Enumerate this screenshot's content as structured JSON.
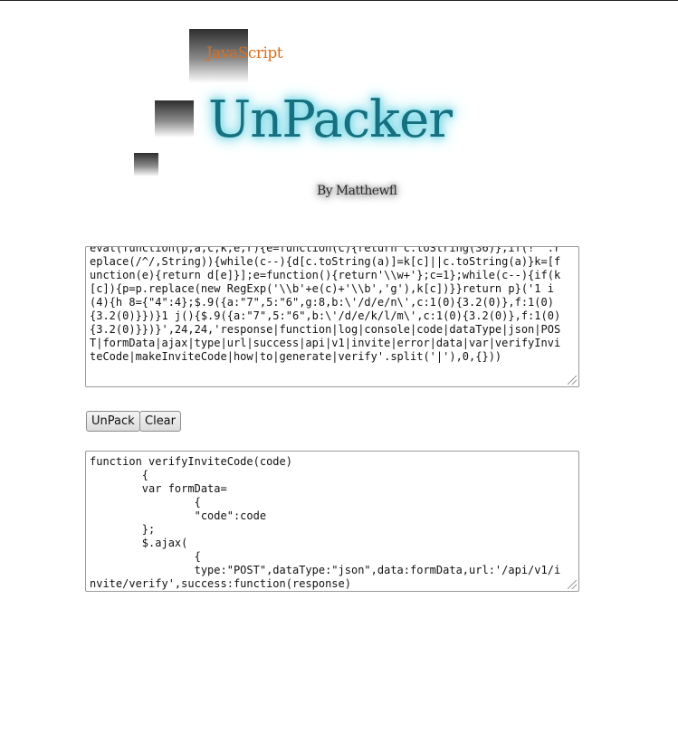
{
  "header": {
    "brand": "JavaScript",
    "title": "UnPacker",
    "byline": "By Matthewfl"
  },
  "input": {
    "text": "eval(function(p,a,c,k,e,r){e=function(c){return c.toString(36)};if(!''.replace(/^/,String)){while(c--){d[c.toString(a)]=k[c]||c.toString(a)}k=[function(e){return d[e]}];e=function(){return'\\\\w+'};c=1};while(c--){if(k[c]){p=p.replace(new RegExp('\\\\b'+e(c)+'\\\\b','g'),k[c])}}return p}('1 i(4){h 8={\"4\":4};$.9({a:\"7\",5:\"6\",g:8,b:\\'/d/e/n\\',c:1(0){3.2(0)},f:1(0){3.2(0)}})}1 j(){$.9({a:\"7\",5:\"6\",b:\\'/d/e/k/l/m\\',c:1(0){3.2(0)},f:1(0){3.2(0)}})}',24,24,'response|function|log|console|code|dataType|json|POST|formData|ajax|type|url|success|api|v1|invite|error|data|var|verifyInviteCode|makeInviteCode|how|to|generate|verify'.split('|'),0,{}))"
  },
  "buttons": {
    "unpack": "UnPack",
    "clear": "Clear"
  },
  "output": {
    "text": "function verifyInviteCode(code)\n\t{\n\tvar formData=\n\t\t{\n\t\t\"code\":code\n\t};\n\t$.ajax(\n\t\t{\n\t\ttype:\"POST\",dataType:\"json\",data:formData,url:'/api/v1/invite/verify',success:function(response)\n\t\t{\n\t\tconsole.log(response)\n\t}"
  }
}
